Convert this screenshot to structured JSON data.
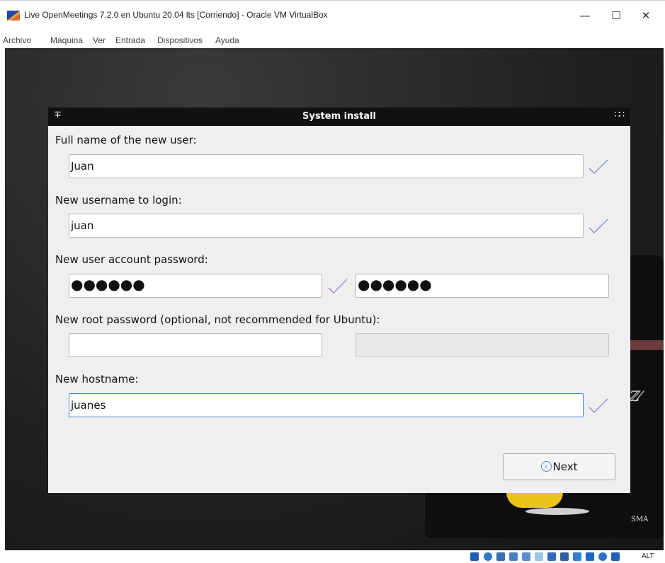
{
  "window": {
    "title": "Live OpenMeetings 7.2.0 en Ubuntu 20.04 lts [Corriendo] - Oracle VM VirtualBox",
    "minimize_glyph": "—",
    "maximize_glyph": "☐",
    "close_glyph": "✕"
  },
  "menu": [
    "Archivo",
    "Máquina",
    "Ver",
    "Entrada",
    "Dispositivos",
    "Ayuda"
  ],
  "dialog": {
    "title": "System install",
    "pin_glyph": "∓",
    "dots_glyph": "∷∷",
    "fullname_label": "Full name of the new user:",
    "fullname_value": "Juan",
    "username_label": "New username to login:",
    "username_value": "juan",
    "password_label": "New user account password:",
    "password_value": "●●●●●●",
    "password_confirm_value": "●●●●●●",
    "root_label": "New root password (optional, not recommended for Ubuntu):",
    "root_value": "",
    "root_confirm_value": "",
    "hostname_label": "New hostname:",
    "hostname_value": "juanes",
    "next_label": "Next",
    "next_glyph": "»"
  },
  "background": {
    "logo_text": "SMA",
    "glyph": "ℤ⁄"
  },
  "status": {
    "host_key": "ALT",
    "tray_colors": [
      "#1f5fb8",
      "#2b78d0",
      "#3a6fb0",
      "#4a7fc0",
      "#5a8fd0",
      "#3a8ad6",
      "#2d6cc0",
      "#2f5fa0",
      "#2d7fd0",
      "#1e66c8"
    ]
  },
  "colors": {
    "accent": "#3d7fd6",
    "check_start": "#c06cd8",
    "check_end": "#6fa0e8"
  }
}
